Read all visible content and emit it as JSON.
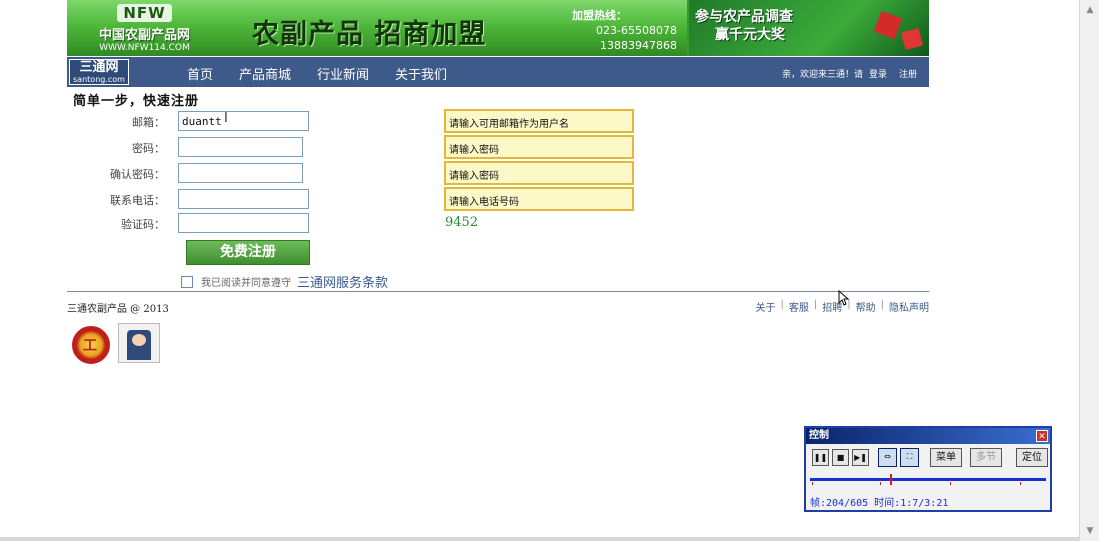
{
  "banner": {
    "logo_mark": "NFW",
    "logo_cn": "中国农副产品网",
    "logo_url": "WWW.NFW114.COM",
    "slogan": "农副产品 招商加盟",
    "hotline_title": "加盟热线：",
    "hotline_1": "023-65508078",
    "hotline_2": "13883947868",
    "survey_line1": "参与农产品调查",
    "survey_line2": "赢千元大奖"
  },
  "nav": {
    "logo_cn": "三通网",
    "logo_en": "santong.com",
    "items": [
      "首页",
      "产品商城",
      "行业新闻",
      "关于我们"
    ],
    "welcome": "亲，欢迎来三通！请",
    "login": "登录",
    "register": "注册"
  },
  "form": {
    "title": "简单一步，快速注册",
    "email_label": "邮箱：",
    "email_value": "duantt",
    "password_label": "密码：",
    "password_value": "",
    "confirm_label": "确认密码：",
    "confirm_value": "",
    "phone_label": "联系电话：",
    "phone_value": "",
    "captcha_label": "验证码：",
    "captcha_value": "",
    "hint_email": "请输入可用邮箱作为用户名",
    "hint_password": "请输入密码",
    "hint_confirm": "请输入密码",
    "hint_phone": "请输入电话号码",
    "captcha_code": "9452",
    "submit_label": "免费注册",
    "agree_text": "我已阅读并同意遵守",
    "agree_link": "三通网服务条款"
  },
  "footer": {
    "copyright": "三通农副产品 @ 2013",
    "links": [
      "关于",
      "客服",
      "招聘",
      "帮助",
      "隐私声明"
    ]
  },
  "control": {
    "title": "控制",
    "menu_label": "菜单",
    "multi_label": "多节",
    "locate_label": "定位",
    "status": "帧:204/605 时间:1:7/3:21",
    "frame_current": 204,
    "frame_total": 605
  },
  "colors": {
    "nav_bg": "#3d5a8a",
    "hint_border": "#e2b83a",
    "hint_bg": "#fdf8c8",
    "button_green": "#4f9f3f",
    "captcha_green": "#2a8a2a",
    "link_blue": "#3a5a8a"
  }
}
